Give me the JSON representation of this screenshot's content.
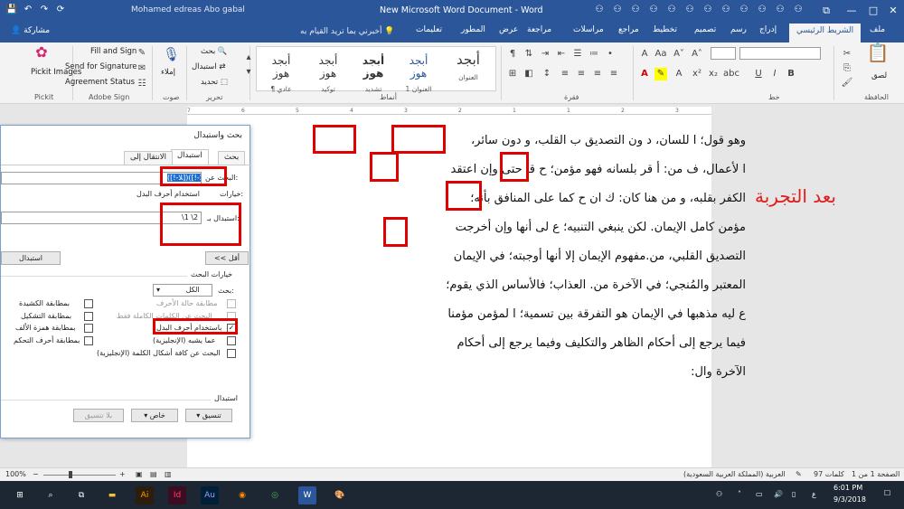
{
  "window": {
    "user": "Mohamed edreas Abo gabal",
    "title": "New Microsoft Word Document  -  Word",
    "minimize": "—",
    "maximize": "□",
    "close": "✕",
    "restore_icon": "⧉"
  },
  "tabs": {
    "file": "ملف",
    "home": "الشريط الرئيسي",
    "insert": "إدراج",
    "draw": "رسم",
    "design": "تصميم",
    "layout": "تخطيط",
    "references": "مراجع",
    "mailings": "مراسلات",
    "review": "مراجعة",
    "view": "عرض",
    "developer": "المطور",
    "help": "تعليمات",
    "tell_me": "أخبرني بما تريد القيام به",
    "share": "مشاركة"
  },
  "ribbon": {
    "groups": {
      "clipboard": "الحافظة",
      "font": "خط",
      "paragraph": "فقرة",
      "styles": "أنماط",
      "editing": "تحرير",
      "voice": "صوت",
      "adobe": "Adobe Sign",
      "pickit": "Pickit"
    },
    "paste": "لصق",
    "find": "بحث",
    "replace": "استبدال",
    "select": "تحديد",
    "dictate": "إملاء",
    "fill_and_sign": "Fill and Sign",
    "send_for_signature": "Send for Signature",
    "agreement_status": "Agreement Status",
    "pickit_images": "Pickit Images",
    "styles": [
      {
        "sample": "أبجد",
        "name": "العنوان"
      },
      {
        "sample": "أبجد هوز",
        "name": "العنوان 1"
      },
      {
        "sample": "أبجد هوز",
        "name": "تشديد"
      },
      {
        "sample": "أبجد هوز",
        "name": "توكيد"
      },
      {
        "sample": "أبجد هوز",
        "name": "¶ عادي"
      }
    ]
  },
  "document": {
    "lines": [
      "وهو قول؛ ا للسان، د ون التصديق ب القلب، و دون سائر،",
      "ا لأعمال، ف من: أ قر بلسانه فهو مؤمن؛ ح قا حتى وإن اعتقد",
      "الكفر بقلبه، و من هنا كان: ك ان  ح كما على المنافق بأنه؛",
      "مؤمن كامل الإيمان. لكن ينبغي التنبيه؛ ع لى أنها وإن أخرجت",
      "التصديق القلبي، من.مفهوم الإيمان إلا أنها أوجبته؛ في الإيمان",
      "المعتبر والمُنجي؛ في الآخرة من. العذاب؛ فالأساس الذي يقوم؛",
      "ع ليه مذهبها في الإيمان هو التفرقة بين تسمية؛ ا لمؤمن مؤمنا",
      "فيما يرجع إلى أحكام الظاهر والتكليف وفيما يرجع إلى أحكام",
      "الآخرة وال:"
    ],
    "annotation": "بعد التجربة"
  },
  "dialog": {
    "title": "بحث واستبدال",
    "tabs": [
      "بحث",
      "استبدال",
      "الانتقال إلى"
    ],
    "find_label": "البحث عن:",
    "find_value": "([!-ﻼ])([!-ﻼ])",
    "options_label": "خيارات:",
    "options_value": "استخدام أحرف البدل",
    "replace_label": "استبدال بـ:",
    "replace_value": "\\1 \\2",
    "less_button": "<< أقل",
    "replace_button": "استبدال",
    "search_options_title": "خيارات البحث",
    "search_label": "بحث:",
    "search_value": "الكل",
    "checkboxes_right": [
      {
        "label": "مطابقة حالة الأحرف",
        "checked": false,
        "disabled": true
      },
      {
        "label": "البحث عن الكلمات الكاملة فقط",
        "checked": false,
        "disabled": true
      },
      {
        "label": "باستخدام أحرف البدل",
        "checked": true,
        "disabled": false
      },
      {
        "label": "عما يشبه (الإنجليزية)",
        "checked": false,
        "disabled": false
      },
      {
        "label": "البحث عن كافة أشكال الكلمة (الإنجليزية)",
        "checked": false,
        "disabled": false
      }
    ],
    "checkboxes_left": [
      {
        "label": "بمطابقة الكشيدة",
        "checked": false
      },
      {
        "label": "بمطابقة التشكيل",
        "checked": false
      },
      {
        "label": "بمطابقة همزة الألف",
        "checked": false
      },
      {
        "label": "بمطابقة أحرف التحكم",
        "checked": false
      }
    ],
    "replace_section": "استبدال",
    "format_button": "تنسيق",
    "special_button": "خاص",
    "no_format_button": "بلا تنسيق"
  },
  "statusbar": {
    "page": "الصفحة 1 من 1",
    "words": "97 كلمات",
    "language": "العربية (المملكة العربية السعودية)",
    "zoom": "100%"
  },
  "taskbar": {
    "time": "6:01 PM",
    "date": "9/3/2018",
    "lang": "ع"
  },
  "colors": {
    "word_blue": "#2b579a",
    "annotation_red": "#e10000"
  }
}
